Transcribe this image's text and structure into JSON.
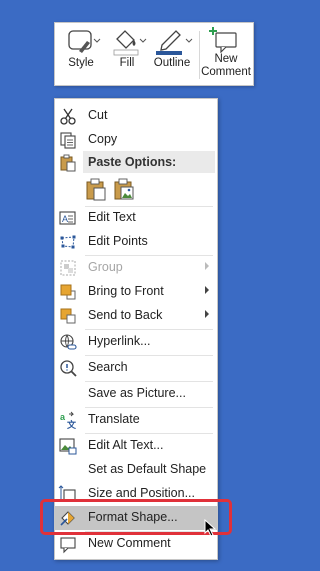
{
  "toolbar": {
    "style_label": "Style",
    "fill_label": "Fill",
    "outline_label": "Outline",
    "new_comment_line1": "New",
    "new_comment_line2": "Comment"
  },
  "menu": {
    "cut": "Cut",
    "copy": "Copy",
    "paste_options": "Paste Options:",
    "edit_text": "Edit Text",
    "edit_points": "Edit Points",
    "group": "Group",
    "bring_to_front": "Bring to Front",
    "send_to_back": "Send to Back",
    "hyperlink": "Hyperlink...",
    "search": "Search",
    "save_as_picture": "Save as Picture...",
    "translate": "Translate",
    "edit_alt_text": "Edit Alt Text...",
    "set_default_shape": "Set as Default Shape",
    "size_and_position": "Size and Position...",
    "format_shape": "Format Shape...",
    "new_comment": "New Comment"
  },
  "colors": {
    "background": "#3b6bc4",
    "highlight": "#c5c5c5",
    "focus_outline": "#e0313a",
    "accent": "#2b579a"
  }
}
